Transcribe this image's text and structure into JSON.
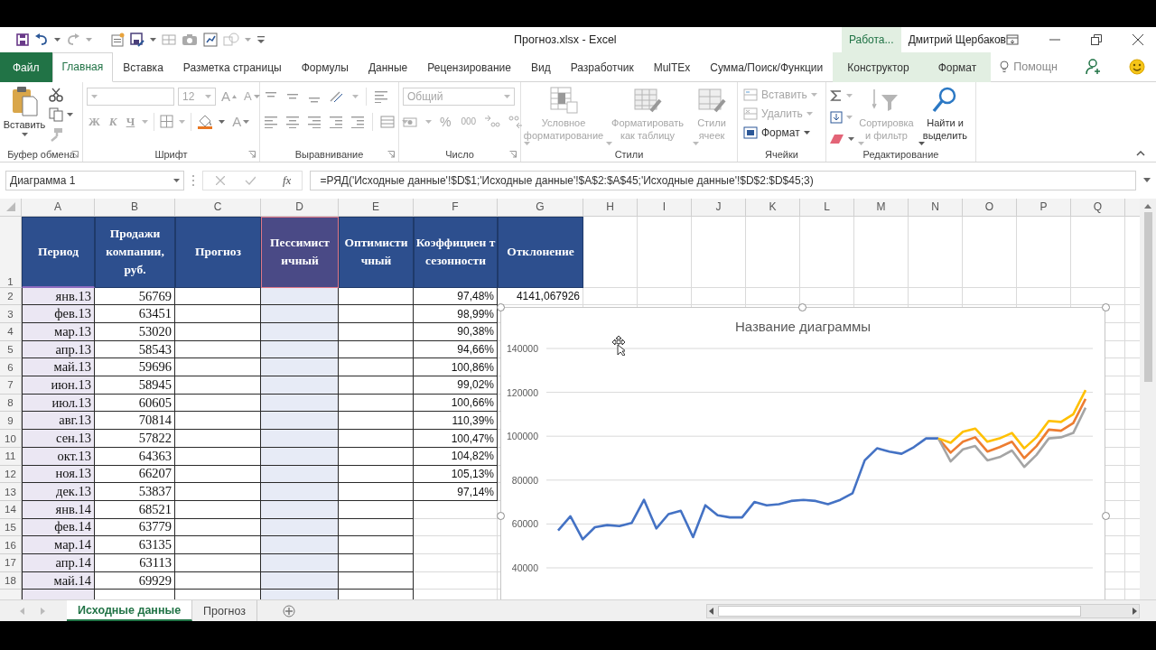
{
  "title_bar": {
    "title": "Прогноз.xlsx - Excel",
    "context_label": "Работа...",
    "user": "Дмитрий Щербаков"
  },
  "tabs": [
    {
      "label": "Файл",
      "kind": "file",
      "selected": false
    },
    {
      "label": "Главная",
      "kind": "normal",
      "selected": true
    },
    {
      "label": "Вставка",
      "kind": "normal",
      "selected": false
    },
    {
      "label": "Разметка страницы",
      "kind": "normal",
      "selected": false
    },
    {
      "label": "Формулы",
      "kind": "normal",
      "selected": false
    },
    {
      "label": "Данные",
      "kind": "normal",
      "selected": false
    },
    {
      "label": "Рецензирование",
      "kind": "normal",
      "selected": false
    },
    {
      "label": "Вид",
      "kind": "normal",
      "selected": false
    },
    {
      "label": "Разработчик",
      "kind": "normal",
      "selected": false
    },
    {
      "label": "MulTEx",
      "kind": "normal",
      "selected": false
    },
    {
      "label": "Сумма/Поиск/Функции",
      "kind": "normal",
      "selected": false
    },
    {
      "label": "Конструктор",
      "kind": "contextual",
      "selected": false
    },
    {
      "label": "Формат",
      "kind": "contextual",
      "selected": false
    }
  ],
  "tell_me": "Помощн",
  "ribbon": {
    "clipboard": {
      "paste": "Вставить",
      "group": "Буфер обмена"
    },
    "font": {
      "size": "12",
      "grow_font": "A",
      "shrink_font": "A",
      "bold": "Ж",
      "italic": "К",
      "underline": "Ч",
      "font_color": "A",
      "group": "Шрифт"
    },
    "alignment": {
      "group": "Выравнивание"
    },
    "number": {
      "format": "Общий",
      "percent": "%",
      "thousands": "000",
      "group": "Число"
    },
    "styles": {
      "buttons": [
        {
          "label": "Условное форматирование",
          "disabled": true
        },
        {
          "label": "Форматировать как таблицу",
          "disabled": true
        },
        {
          "label": "Стили ячеек",
          "disabled": true
        }
      ],
      "group": "Стили"
    },
    "cells": {
      "buttons": [
        {
          "label": "Вставить",
          "disabled": true
        },
        {
          "label": "Удалить",
          "disabled": true
        },
        {
          "label": "Формат",
          "disabled": false
        }
      ],
      "group": "Ячейки"
    },
    "editing": {
      "buttons": [
        {
          "label": "Сортировка и фильтр",
          "disabled": true
        },
        {
          "label": "Найти и выделить",
          "disabled": false
        }
      ],
      "group": "Редактирование"
    }
  },
  "formula_bar": {
    "name_box": "Диаграмма 1",
    "function_label": "fx",
    "formula": "=РЯД('Исходные данные'!$D$1;'Исходные данные'!$A$2:$A$45;'Исходные данные'!$D$2:$D$45;3)"
  },
  "sheet": {
    "columns": [
      {
        "letter": "A",
        "kind": "category"
      },
      {
        "letter": "B",
        "kind": "plain"
      },
      {
        "letter": "C",
        "kind": "plain"
      },
      {
        "letter": "D",
        "kind": "values"
      },
      {
        "letter": "E",
        "kind": "plain"
      },
      {
        "letter": "F",
        "kind": "plain"
      },
      {
        "letter": "G",
        "kind": "plain"
      },
      {
        "letter": "H",
        "kind": "plain"
      },
      {
        "letter": "I",
        "kind": "plain"
      },
      {
        "letter": "J",
        "kind": "plain"
      },
      {
        "letter": "K",
        "kind": "plain"
      },
      {
        "letter": "L",
        "kind": "plain"
      },
      {
        "letter": "M",
        "kind": "plain"
      },
      {
        "letter": "N",
        "kind": "plain"
      },
      {
        "letter": "O",
        "kind": "plain"
      },
      {
        "letter": "P",
        "kind": "plain"
      },
      {
        "letter": "Q",
        "kind": "plain"
      }
    ],
    "header_row": {
      "num": "1",
      "cells": [
        "Период",
        "Продажи компании, руб.",
        "Прогноз",
        "Пессимист ичный",
        "Оптимисти чный",
        "Коэффициен т сезонности",
        "Отклонение"
      ]
    },
    "rows": [
      {
        "num": "2",
        "period": "янв.13",
        "sales": "56769",
        "coef": "97,48%",
        "deviation": "4141,067926"
      },
      {
        "num": "3",
        "period": "фев.13",
        "sales": "63451",
        "coef": "98,99%"
      },
      {
        "num": "4",
        "period": "мар.13",
        "sales": "53020",
        "coef": "90,38%"
      },
      {
        "num": "5",
        "period": "апр.13",
        "sales": "58543",
        "coef": "94,66%"
      },
      {
        "num": "6",
        "period": "май.13",
        "sales": "59696",
        "coef": "100,86%"
      },
      {
        "num": "7",
        "period": "июн.13",
        "sales": "58945",
        "coef": "99,02%"
      },
      {
        "num": "8",
        "period": "июл.13",
        "sales": "60605",
        "coef": "100,66%"
      },
      {
        "num": "9",
        "period": "авг.13",
        "sales": "70814",
        "coef": "110,39%"
      },
      {
        "num": "10",
        "period": "сен.13",
        "sales": "57822",
        "coef": "100,47%"
      },
      {
        "num": "11",
        "period": "окт.13",
        "sales": "64363",
        "coef": "104,82%"
      },
      {
        "num": "12",
        "period": "ноя.13",
        "sales": "66207",
        "coef": "105,13%"
      },
      {
        "num": "13",
        "period": "дек.13",
        "sales": "53837",
        "coef": "97,14%"
      },
      {
        "num": "14",
        "period": "янв.14",
        "sales": "68521"
      },
      {
        "num": "15",
        "period": "фев.14",
        "sales": "63779"
      },
      {
        "num": "16",
        "period": "мар.14",
        "sales": "63135"
      },
      {
        "num": "17",
        "period": "апр.14",
        "sales": "63113"
      },
      {
        "num": "18",
        "period": "май.14",
        "sales": "69929"
      }
    ]
  },
  "chart": {
    "chart_data": {
      "type": "line",
      "title": "Название диаграммы",
      "ylim": [
        40000,
        140000
      ],
      "yticks": [
        40000,
        60000,
        80000,
        100000,
        120000,
        140000
      ],
      "grid": true,
      "series": [
        {
          "color": "#4472c4",
          "values": [
            57000,
            63500,
            53000,
            58500,
            59500,
            59000,
            60500,
            71000,
            58000,
            64500,
            66000,
            54000,
            68500,
            64000,
            63000,
            63000,
            70000,
            68500,
            69000,
            70500,
            71000,
            70500,
            69000,
            71000,
            74000,
            89000,
            94500,
            93000,
            92000,
            95000,
            99000,
            99000,
            null,
            null,
            null,
            null,
            null,
            null,
            null,
            null,
            null,
            null,
            null,
            null
          ]
        },
        {
          "color": "#ed7d31",
          "values": [
            null,
            null,
            null,
            null,
            null,
            null,
            null,
            null,
            null,
            null,
            null,
            null,
            null,
            null,
            null,
            null,
            null,
            null,
            null,
            null,
            null,
            null,
            null,
            null,
            null,
            null,
            null,
            null,
            null,
            null,
            null,
            99000,
            92500,
            97500,
            99500,
            93000,
            95000,
            97500,
            90000,
            95500,
            103000,
            102500,
            106000,
            117000
          ]
        },
        {
          "color": "#a5a5a5",
          "values": [
            null,
            null,
            null,
            null,
            null,
            null,
            null,
            null,
            null,
            null,
            null,
            null,
            null,
            null,
            null,
            null,
            null,
            null,
            null,
            null,
            null,
            null,
            null,
            null,
            null,
            null,
            null,
            null,
            null,
            null,
            null,
            99000,
            88500,
            94000,
            95500,
            89000,
            90500,
            93500,
            86000,
            91500,
            99000,
            99500,
            101500,
            113000
          ]
        },
        {
          "color": "#ffc000",
          "values": [
            null,
            null,
            null,
            null,
            null,
            null,
            null,
            null,
            null,
            null,
            null,
            null,
            null,
            null,
            null,
            null,
            null,
            null,
            null,
            null,
            null,
            null,
            null,
            null,
            null,
            null,
            null,
            null,
            null,
            null,
            null,
            99000,
            97000,
            102000,
            103500,
            97500,
            99000,
            101500,
            94500,
            99500,
            107000,
            106500,
            110000,
            121000
          ]
        }
      ]
    }
  },
  "sheet_tabs": [
    {
      "label": "Исходные данные",
      "selected": true
    },
    {
      "label": "Прогноз",
      "selected": false
    }
  ]
}
